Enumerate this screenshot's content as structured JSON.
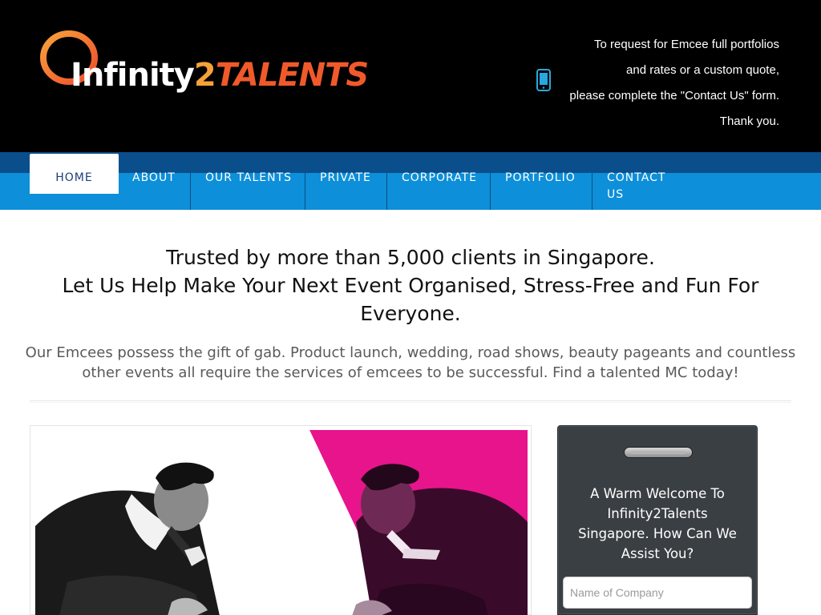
{
  "brand": {
    "logo_part1": "Infinity",
    "logo_part2": "2",
    "logo_part3": "TALENTS",
    "accent_orange": "#f6a23a",
    "accent_red": "#f05a2a"
  },
  "header": {
    "contact_lines": [
      "To request for Emcee full portfolios",
      "and rates or a custom quote,",
      "please complete the \"Contact Us\" form.",
      "Thank you."
    ],
    "phone_icon": "mobile-phone-icon"
  },
  "nav": {
    "items": [
      {
        "label": "HOME",
        "active": true
      },
      {
        "label": "ABOUT"
      },
      {
        "label": "OUR TALENTS"
      },
      {
        "label": "PRIVATE"
      },
      {
        "label": "CORPORATE"
      },
      {
        "label": "PORTFOLIO"
      },
      {
        "label": "CONTACT US"
      }
    ],
    "bar_color": "#0d8fd9"
  },
  "hero": {
    "title_line1": "Trusted by more than 5,000 clients in Singapore.",
    "title_line2": "Let Us Help Make Your Next Event Organised, Stress-Free and Fun For Everyone.",
    "description": "Our Emcees possess the gift of gab. Product launch, wedding, road shows, beauty pageants and countless other events all require the services of emcees to be successful. Find a talented MC today!"
  },
  "enquiry": {
    "title": "A Warm Welcome To Infinity2Talents Singapore. How Can We Assist You?",
    "company_placeholder": "Name of Company"
  }
}
